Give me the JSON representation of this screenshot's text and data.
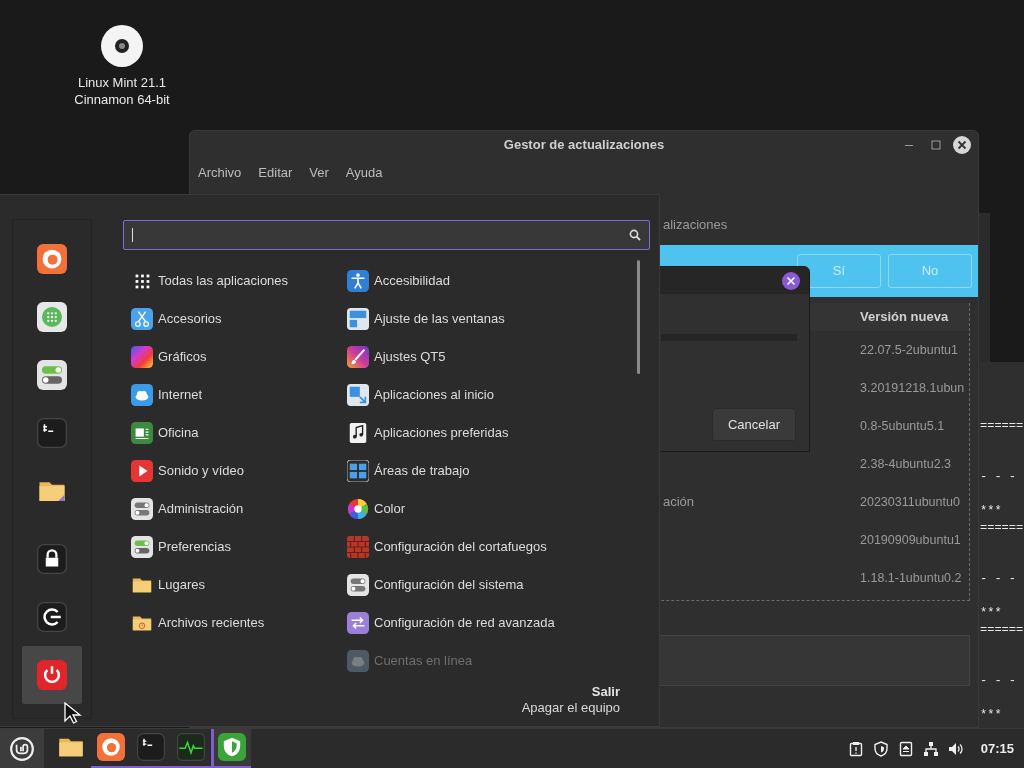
{
  "desktop": {
    "icon_label_lines": [
      "Linux Mint 21.1",
      "Cinnamon 64-bit"
    ]
  },
  "terminal": {
    "blocks": [
      {
        "rule": "======",
        "dashes": "- - -",
        "stars": "***"
      },
      {
        "rule": "======",
        "dashes": "- - -",
        "stars": "***"
      },
      {
        "rule": "======",
        "dashes": "- - -",
        "stars": "***"
      }
    ]
  },
  "update_window": {
    "title": "Gestor de actualizaciones",
    "menu": [
      "Archivo",
      "Editar",
      "Ver",
      "Ayuda"
    ],
    "partial_label": "alizaciones",
    "info_bar": {
      "buttons": [
        "Sí",
        "No"
      ]
    },
    "table": {
      "columns": [
        "Versión nueva"
      ],
      "rows": [
        {
          "version": "22.07.5-2ubuntu1"
        },
        {
          "version": "3.20191218.1ubun"
        },
        {
          "version": "0.8-5ubuntu5.1"
        },
        {
          "version": "2.38-4ubuntu2.3"
        },
        {
          "description": "ación",
          "version": "20230311ubuntu0"
        },
        {
          "version": "20190909ubuntu1"
        },
        {
          "version": "1.18.1-1ubuntu0.2"
        }
      ]
    }
  },
  "dialog": {
    "button": "Cancelar"
  },
  "menu": {
    "search": {
      "focused": true
    },
    "favorites": [
      {
        "selected": false
      },
      {
        "selected": false
      },
      {
        "selected": false
      },
      {
        "selected": false
      },
      {
        "selected": false
      }
    ],
    "session": [
      {
        "selected": false
      },
      {
        "selected": false
      },
      {
        "selected": true
      }
    ],
    "categories": [
      {
        "label": "Todas las aplicaciones"
      },
      {
        "label": "Accesorios"
      },
      {
        "label": "Gráficos"
      },
      {
        "label": "Internet"
      },
      {
        "label": "Oficina"
      },
      {
        "label": "Sonido y vídeo"
      },
      {
        "label": "Administración"
      },
      {
        "label": "Preferencias"
      },
      {
        "label": "Lugares"
      },
      {
        "label": "Archivos recientes"
      }
    ],
    "apps": [
      {
        "label": "Accesibilidad",
        "disabled": false
      },
      {
        "label": "Ajuste de las ventanas",
        "disabled": false
      },
      {
        "label": "Ajustes QT5",
        "disabled": false
      },
      {
        "label": "Aplicaciones al inicio",
        "disabled": false
      },
      {
        "label": "Aplicaciones preferidas",
        "disabled": false
      },
      {
        "label": "Áreas de trabajo",
        "disabled": false
      },
      {
        "label": "Color",
        "disabled": false
      },
      {
        "label": "Configuración del cortafuegos",
        "disabled": false
      },
      {
        "label": "Configuración del sistema",
        "disabled": false
      },
      {
        "label": "Configuración de red avanzada",
        "disabled": false
      },
      {
        "label": "Cuentas en línea",
        "disabled": true
      }
    ],
    "footer": {
      "title": "Salir",
      "subtitle": "Apagar el equipo"
    }
  },
  "taskbar": {
    "launchers": [
      {
        "running": false,
        "active": false
      },
      {
        "running": true,
        "active": false
      },
      {
        "running": true,
        "active": false
      },
      {
        "running": true,
        "active": false
      },
      {
        "running": true,
        "active": true
      }
    ],
    "clock": "07:15"
  }
}
